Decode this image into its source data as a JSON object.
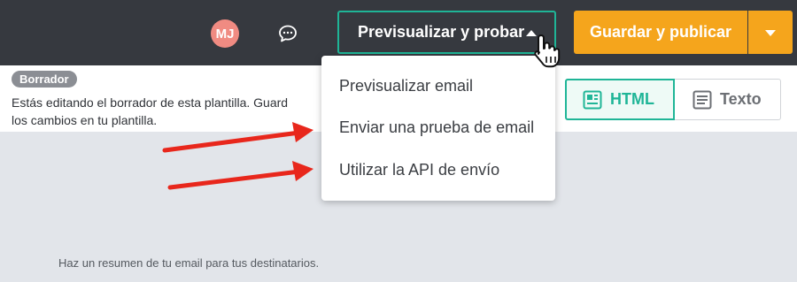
{
  "header": {
    "avatar_initials": "MJ",
    "chat_icon": "chat-bubble-icon",
    "preview_button_label": "Previsualizar y probar",
    "save_button_label": "Guardar y publicar",
    "accent_color": "#1fb597",
    "save_color": "#f5a51c"
  },
  "draft": {
    "badge": "Borrador",
    "text": "Estás editando el borrador de esta plantilla. Guard\nlos cambios en tu plantilla."
  },
  "view_toggle": {
    "html_label": "HTML",
    "text_label": "Texto",
    "selected": "HTML"
  },
  "dropdown": {
    "items": [
      {
        "label": "Previsualizar email"
      },
      {
        "label": "Enviar una prueba de email"
      },
      {
        "label": "Utilizar la API de envío"
      }
    ]
  },
  "content": {
    "summary_hint": "Haz un resumen de tu email para tus destinatarios."
  }
}
